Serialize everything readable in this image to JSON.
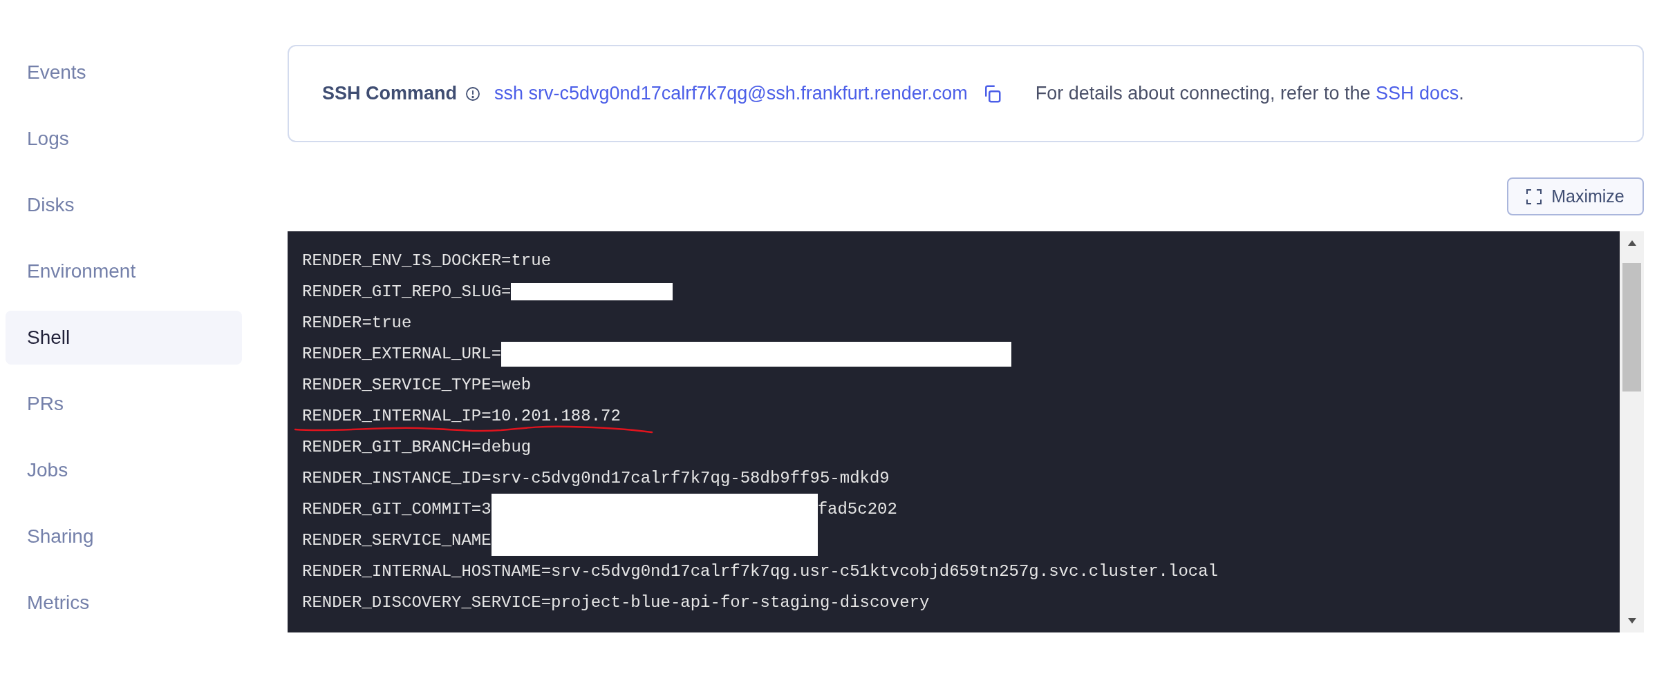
{
  "sidebar": {
    "items": [
      {
        "label": "Events",
        "selected": false
      },
      {
        "label": "Logs",
        "selected": false
      },
      {
        "label": "Disks",
        "selected": false
      },
      {
        "label": "Environment",
        "selected": false
      },
      {
        "label": "Shell",
        "selected": true
      },
      {
        "label": "PRs",
        "selected": false
      },
      {
        "label": "Jobs",
        "selected": false
      },
      {
        "label": "Sharing",
        "selected": false
      },
      {
        "label": "Metrics",
        "selected": false
      }
    ]
  },
  "ssh_card": {
    "label": "SSH Command",
    "command": "ssh srv-c5dvg0nd17calrf7k7qg@ssh.frankfurt.render.com",
    "details_text": "For details about connecting, refer to the",
    "details_link": "SSH docs",
    "details_end": "."
  },
  "maximize_button": {
    "label": "Maximize"
  },
  "terminal": {
    "lines": [
      {
        "parts": [
          {
            "kind": "text",
            "text": "RENDER_ENV_IS_DOCKER=true"
          }
        ]
      },
      {
        "parts": [
          {
            "kind": "text",
            "text": "RENDER_GIT_REPO_SLUG="
          },
          {
            "kind": "short_redaction"
          }
        ]
      },
      {
        "parts": [
          {
            "kind": "text",
            "text": "RENDER=true"
          }
        ]
      },
      {
        "parts": [
          {
            "kind": "text",
            "text": "RENDER_EXTERNAL_URL="
          },
          {
            "kind": "wide_redaction"
          }
        ]
      },
      {
        "parts": [
          {
            "kind": "text",
            "text": "RENDER_SERVICE_TYPE=web"
          }
        ]
      },
      {
        "parts": [
          {
            "kind": "text",
            "text": "RENDER_INTERNAL_IP=10.201.188.72"
          }
        ],
        "underlined": true
      },
      {
        "parts": [
          {
            "kind": "text",
            "text": "RENDER_GIT_BRANCH=debug"
          }
        ]
      },
      {
        "parts": [
          {
            "kind": "text",
            "text": "RENDER_INSTANCE_ID=srv-c5dvg0nd17calrf7k7qg-58db9ff95-mdkd9"
          }
        ]
      },
      {
        "parts": [
          {
            "kind": "text",
            "text": "RENDER_GIT_COMMIT=3"
          },
          {
            "kind": "block_redaction"
          },
          {
            "kind": "text",
            "text": "fad5c202"
          }
        ]
      },
      {
        "parts": [
          {
            "kind": "text",
            "text": "RENDER_SERVICE_NAME"
          },
          {
            "kind": "block_redaction"
          }
        ]
      },
      {
        "parts": [
          {
            "kind": "text",
            "text": "RENDER_INTERNAL_HOSTNAME=srv-c5dvg0nd17calrf7k7qg.usr-c51ktvcobjd659tn257g.svc.cluster.local"
          }
        ]
      },
      {
        "parts": [
          {
            "kind": "text",
            "text": "RENDER_DISCOVERY_SERVICE=project-blue-api-for-staging-discovery"
          }
        ]
      }
    ]
  }
}
